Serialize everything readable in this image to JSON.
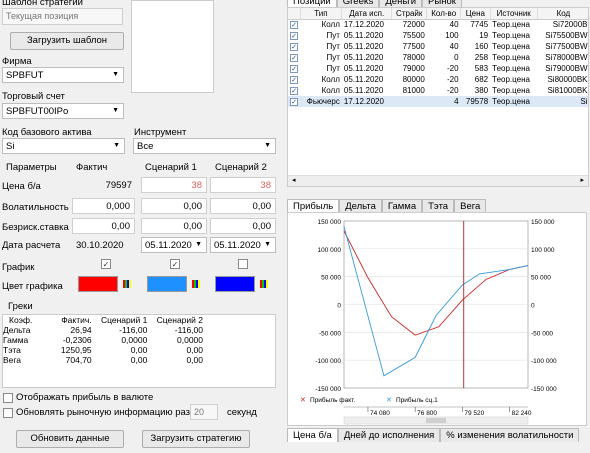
{
  "left": {
    "strategy_template_label": "Шаблон стратегии",
    "current_position_value": "Текущая позиция",
    "load_template_label": "Загрузить шаблон",
    "firm_label": "Фирма",
    "firm_value": "SPBFUT",
    "account_label": "Торговый счет",
    "account_value": "SPBFUT00IPo",
    "base_asset_label": "Код базового актива",
    "base_asset_value": "Si",
    "instrument_label": "Инструмент",
    "instrument_value": "Все",
    "params": {
      "header": "Параметры",
      "col_fact": "Фактич",
      "col_s1": "Сценарий 1",
      "col_s2": "Сценарий 2",
      "price_label": "Цена б/а",
      "price_fact": "79597",
      "price_s1": "38",
      "price_s2": "38",
      "vol_label": "Волатильность",
      "vol_fact": "0,000",
      "vol_s1": "0,00",
      "vol_s2": "0,00",
      "rate_label": "Безриск.ставка",
      "rate_fact": "0,00",
      "rate_s1": "0,00",
      "rate_s2": "0,00",
      "date_label": "Дата расчета",
      "date_fact": "30.10.2020",
      "date_s1": "05.11.2020",
      "date_s2": "05.11.2020",
      "chart_label": "График",
      "color_label": "Цвет графика",
      "color_fact": "#ff0000",
      "color_s1": "#1e90ff",
      "color_s2": "#0000ff"
    },
    "greeks": {
      "title": "Греки",
      "headers": [
        "Коэф.",
        "Фактич.",
        "Сценарий 1",
        "Сценарий 2"
      ],
      "rows": [
        [
          "Дельта",
          "26,94",
          "-116,00",
          "-116,00"
        ],
        [
          "Гамма",
          "-0,2306",
          "0,0000",
          "0,0000"
        ],
        [
          "Тэта",
          "1250,95",
          "0,00",
          "0,00"
        ],
        [
          "Вега",
          "704,70",
          "0,00",
          "0,00"
        ]
      ]
    },
    "show_profit_currency": "Отображать прибыль в валюте",
    "refresh_market_label": "Обновлять рыночную информацию раз в",
    "refresh_value": "20",
    "seconds_label": "секунд",
    "update_data_label": "Обновить данные",
    "load_strategy_label": "Загрузить стратегию"
  },
  "right": {
    "top_tabs": [
      "Позиции",
      "Greeks",
      "Деньги",
      "Рынок"
    ],
    "positions_headers": [
      "",
      "Тип",
      "Дата исп.",
      "Страйк",
      "Кол-во",
      "Цена",
      "Источник",
      "Код"
    ],
    "positions": [
      [
        "✓",
        "Колл",
        "17.12.2020",
        "72000",
        "40",
        "7745",
        "Теор.цена",
        "Si72000B"
      ],
      [
        "✓",
        "Пут",
        "05.11.2020",
        "75500",
        "100",
        "19",
        "Теор.цена",
        "Si75500BW"
      ],
      [
        "✓",
        "Пут",
        "05.11.2020",
        "77500",
        "40",
        "160",
        "Теор.цена",
        "Si77500BW"
      ],
      [
        "✓",
        "Пут",
        "05.11.2020",
        "78000",
        "0",
        "258",
        "Теор.цена",
        "Si78000BW"
      ],
      [
        "✓",
        "Пут",
        "05.11.2020",
        "79000",
        "-20",
        "583",
        "Теор.цена",
        "Si79000BW"
      ],
      [
        "✓",
        "Колл",
        "05.11.2020",
        "80000",
        "-20",
        "682",
        "Теор.цена",
        "Si80000BK"
      ],
      [
        "✓",
        "Колл",
        "05.11.2020",
        "81000",
        "-20",
        "380",
        "Теор.цена",
        "Si81000BK"
      ],
      [
        "✓",
        "Фьючерс",
        "17.12.2020",
        "",
        "4",
        "79578",
        "Теор.цена",
        "Si"
      ]
    ],
    "chart_tabs": [
      "Прибыль",
      "Дельта",
      "Гамма",
      "Тэта",
      "Вега"
    ],
    "bottom_tabs": [
      "Цена б/а",
      "Дней до исполнения",
      "% изменения волатильности"
    ],
    "legend_fact": "Прибыль факт.",
    "legend_s1": "Прибыль сц.1"
  },
  "chart_data": {
    "type": "line",
    "ylim": [
      -150000,
      150000
    ],
    "y_ticks": [
      "150 000",
      "100 000",
      "50 000",
      "0",
      "-50 000",
      "-100 000",
      "-150 000"
    ],
    "x_ticks": [
      "74 080",
      "76 800",
      "79 520",
      "82 240"
    ],
    "series": [
      {
        "name": "Прибыль факт.",
        "color": "#cc2222",
        "x": [
          72700,
          74080,
          75440,
          76800,
          78160,
          79520,
          80880,
          82240,
          83300
        ],
        "y": [
          132000,
          48000,
          -22000,
          -55000,
          -40000,
          8000,
          45000,
          63000,
          70000
        ]
      },
      {
        "name": "Прибыль сц.1",
        "color": "#3399dd",
        "x": [
          72700,
          75000,
          76800,
          78000,
          79520,
          80500,
          82240,
          83300
        ],
        "y": [
          140000,
          -128000,
          -95000,
          -20000,
          35000,
          55000,
          63000,
          70000
        ]
      }
    ],
    "vline_x": 79597
  }
}
